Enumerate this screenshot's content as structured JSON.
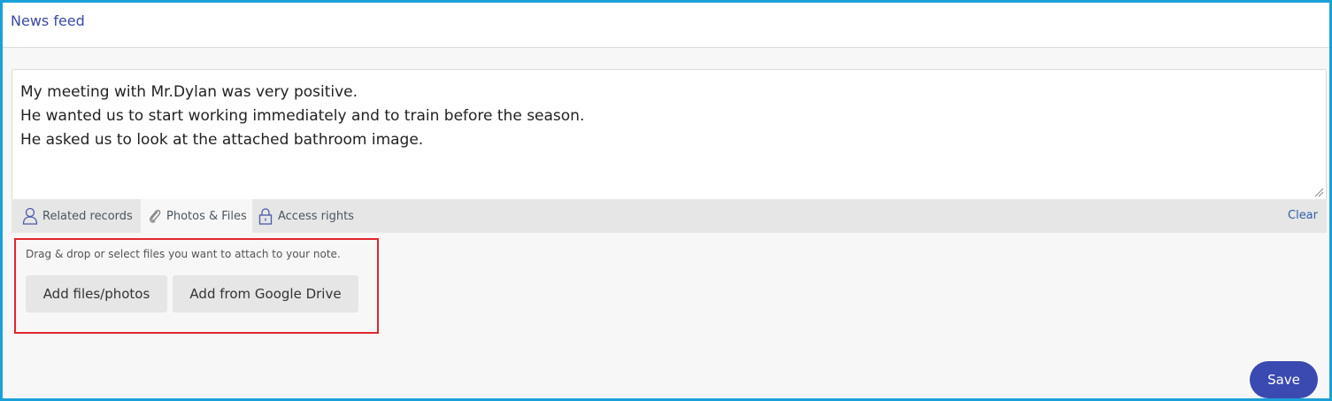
{
  "header": {
    "title": "News feed"
  },
  "editor": {
    "lines": [
      "My meeting with Mr.Dylan was very positive.",
      "He wanted us to start working immediately and to train before the season.",
      "He asked us to look at the attached bathroom image."
    ]
  },
  "toolbar": {
    "tabs": [
      {
        "label": "Related records",
        "icon": "person-icon"
      },
      {
        "label": "Photos & Files",
        "icon": "paperclip-icon",
        "active": true
      },
      {
        "label": "Access rights",
        "icon": "lock-icon"
      }
    ],
    "clear_label": "Clear"
  },
  "attach": {
    "hint": "Drag & drop or select files you want to attach to your note.",
    "add_files_label": "Add files/photos",
    "google_drive_label": "Add from Google Drive"
  },
  "actions": {
    "save_label": "Save"
  },
  "colors": {
    "frame_border": "#1aa0d8",
    "accent": "#3b4ab0",
    "title": "#3a49a6",
    "highlight_box": "#e0272d"
  }
}
